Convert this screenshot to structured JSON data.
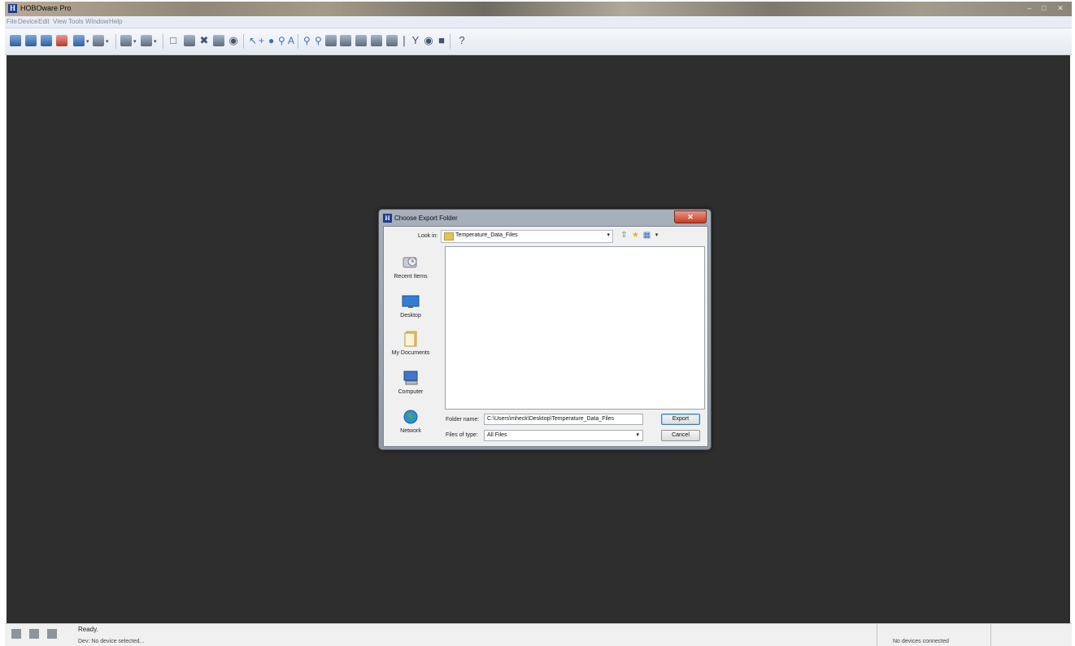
{
  "window": {
    "title": "HOBOware Pro",
    "controls": [
      "–",
      "□",
      "✕"
    ]
  },
  "menu": [
    "File",
    "Device",
    "Edit",
    "View",
    "Tools",
    "Window",
    "Help"
  ],
  "dialog": {
    "title": "Choose Export Folder",
    "close_label": "✕",
    "look_in_label": "Look in:",
    "look_in_value": "Temperature_Data_Files",
    "places": [
      {
        "label": "Recent Items",
        "icon": "recent-items-icon"
      },
      {
        "label": "Desktop",
        "icon": "desktop-icon"
      },
      {
        "label": "My Documents",
        "icon": "my-documents-icon"
      },
      {
        "label": "Computer",
        "icon": "computer-icon"
      },
      {
        "label": "Network",
        "icon": "network-icon"
      }
    ],
    "folder_name_label": "Folder name:",
    "folder_name_value": "C:\\Users\\mheck\\Desktop\\Temperature_Data_Files",
    "file_type_label": "Files of type:",
    "file_type_value": "All Files",
    "export_label": "Export",
    "cancel_label": "Cancel"
  },
  "status": {
    "ready": "Ready.",
    "device": "Dev: No device selected...",
    "connection": "No devices connected"
  },
  "colors": {
    "workspace": "#2e2e2e",
    "dialog_frame": "#9aa3ae",
    "close_button": "#c43b23"
  }
}
